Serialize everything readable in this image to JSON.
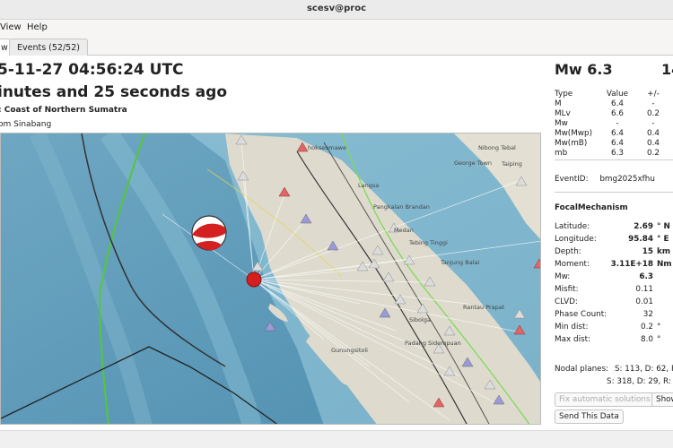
{
  "window": {
    "title": "scesv@proc"
  },
  "menu": {
    "view": "View",
    "help": "Help"
  },
  "tabs": {
    "summary_partial": "w",
    "events": "Events (52/52)"
  },
  "event": {
    "origin_time": "5-11-27 04:56:24 UTC",
    "ago": "inutes and 25 seconds ago",
    "region": ": Coast of Northern Sumatra",
    "nearby": "om Sinabang"
  },
  "map": {
    "places": [
      "hokseumawe",
      "Nibong Tebal",
      "George Town",
      "Taiping",
      "Langsa",
      "Pangkalan Brandan",
      "Medan",
      "Tebing Tinggi",
      "Tanjung Balai",
      "Rantau Prapat",
      "Padang Sidempuan",
      "Gunungsitoli",
      "Sibolga"
    ],
    "colors": {
      "sea": "#5f9bb8",
      "land": "#dfdccf",
      "plate_boundary": "#56c63c",
      "station_normal": "#dcdcdc",
      "station_blue": "#9a9ad8",
      "station_red": "#e06666",
      "epicenter": "#d42020"
    }
  },
  "magnitude": {
    "headline": "Mw 6.3",
    "time_partial": "14",
    "columns": [
      "Type",
      "Value",
      "+/-"
    ],
    "rows": [
      [
        "M",
        "6.4",
        "-"
      ],
      [
        "MLv",
        "6.6",
        "0.2"
      ],
      [
        "Mw",
        "-",
        "-"
      ],
      [
        "Mw(Mwp)",
        "6.4",
        "0.4"
      ],
      [
        "Mw(mB)",
        "6.4",
        "0.4"
      ],
      [
        "mb",
        "6.3",
        "0.2"
      ]
    ]
  },
  "event_id": {
    "label": "EventID:",
    "value": "bmg2025xfhu"
  },
  "focal_mechanism": {
    "title": "FocalMechanism",
    "rows": [
      {
        "label": "Latitude:",
        "value": "2.69",
        "unit": "° N"
      },
      {
        "label": "Longitude:",
        "value": "95.84",
        "unit": "° E"
      },
      {
        "label": "Depth:",
        "value": "15",
        "unit": "km"
      },
      {
        "label": "Moment:",
        "value": "3.11E+18",
        "unit": "Nm"
      },
      {
        "label": "Mw:",
        "value": "6.3",
        "unit": ""
      },
      {
        "label": "Misfit:",
        "value": "0.11",
        "unit": ""
      },
      {
        "label": "CLVD:",
        "value": "0.01",
        "unit": ""
      },
      {
        "label": "Phase Count:",
        "value": "32",
        "unit": ""
      },
      {
        "label": "Min dist:",
        "value": "0.2",
        "unit": "°"
      },
      {
        "label": "Max dist:",
        "value": "8.0",
        "unit": "°"
      }
    ],
    "nodal_label": "Nodal planes:",
    "nodal1": "S: 113, D: 62, R: ",
    "nodal2": "S: 318, D: 29, R: "
  },
  "buttons": {
    "fix_automatic": "Fix automatic solutions",
    "show": "Show",
    "send": "Send This Data"
  }
}
